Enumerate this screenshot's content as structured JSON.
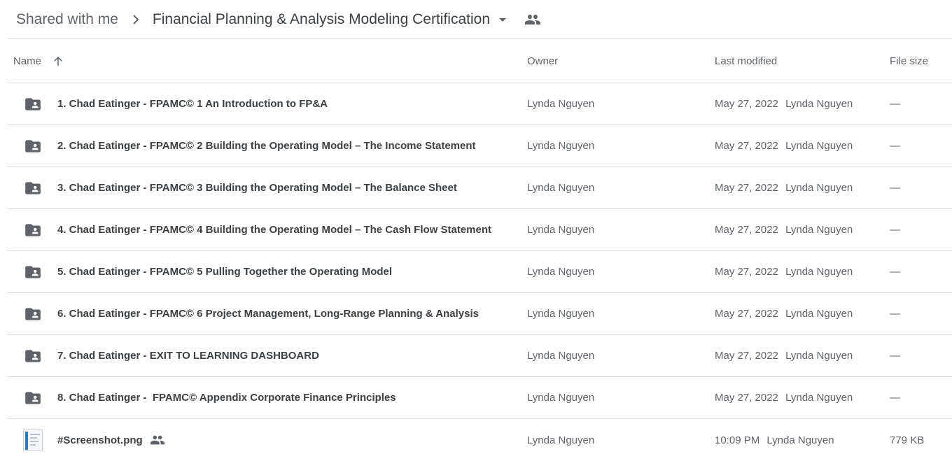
{
  "breadcrumb": {
    "parent": "Shared with me",
    "current": "Financial Planning & Analysis Modeling Certification",
    "separator_icon": "chevron-right-icon",
    "dropdown_icon": "arrow-drop-down-icon",
    "shared_icon": "people-icon"
  },
  "columns": {
    "name": "Name",
    "owner": "Owner",
    "modified": "Last modified",
    "size": "File size",
    "sort_icon": "arrow-up-icon"
  },
  "rows": [
    {
      "type": "shared-folder",
      "title": "1. Chad Eatinger - FPAMC© 1 An Introduction to FP&A",
      "owner": "Lynda Nguyen",
      "modified_date": "May 27, 2022",
      "modified_by": "Lynda Nguyen",
      "size": "—"
    },
    {
      "type": "shared-folder",
      "title": "2. Chad Eatinger - FPAMC© 2 Building the Operating Model – The Income Statement",
      "owner": "Lynda Nguyen",
      "modified_date": "May 27, 2022",
      "modified_by": "Lynda Nguyen",
      "size": "—"
    },
    {
      "type": "shared-folder",
      "title": "3. Chad Eatinger - FPAMC© 3 Building the Operating Model – The Balance Sheet",
      "owner": "Lynda Nguyen",
      "modified_date": "May 27, 2022",
      "modified_by": "Lynda Nguyen",
      "size": "—"
    },
    {
      "type": "shared-folder",
      "title": "4. Chad Eatinger - FPAMC© 4 Building the Operating Model – The Cash Flow Statement",
      "owner": "Lynda Nguyen",
      "modified_date": "May 27, 2022",
      "modified_by": "Lynda Nguyen",
      "size": "—"
    },
    {
      "type": "shared-folder",
      "title": "5. Chad Eatinger - FPAMC© 5 Pulling Together the Operating Model",
      "owner": "Lynda Nguyen",
      "modified_date": "May 27, 2022",
      "modified_by": "Lynda Nguyen",
      "size": "—"
    },
    {
      "type": "shared-folder",
      "title": "6. Chad Eatinger - FPAMC© 6 Project Management, Long-Range Planning & Analysis",
      "owner": "Lynda Nguyen",
      "modified_date": "May 27, 2022",
      "modified_by": "Lynda Nguyen",
      "size": "—"
    },
    {
      "type": "shared-folder",
      "title": "7. Chad Eatinger - EXIT TO LEARNING DASHBOARD",
      "owner": "Lynda Nguyen",
      "modified_date": "May 27, 2022",
      "modified_by": "Lynda Nguyen",
      "size": "—"
    },
    {
      "type": "shared-folder",
      "title": "8. Chad Eatinger -  FPAMC© Appendix Corporate Finance Principles",
      "owner": "Lynda Nguyen",
      "modified_date": "May 27, 2022",
      "modified_by": "Lynda Nguyen",
      "size": "—"
    },
    {
      "type": "image",
      "title": "#Screenshot.png",
      "shared": true,
      "owner": "Lynda Nguyen",
      "modified_date": "10:09 PM",
      "modified_by": "Lynda Nguyen",
      "size": "779 KB"
    }
  ],
  "colors": {
    "text": "#3c4043",
    "secondary": "#5f6368",
    "divider": "#dadce0",
    "icon": "#5f6368"
  }
}
